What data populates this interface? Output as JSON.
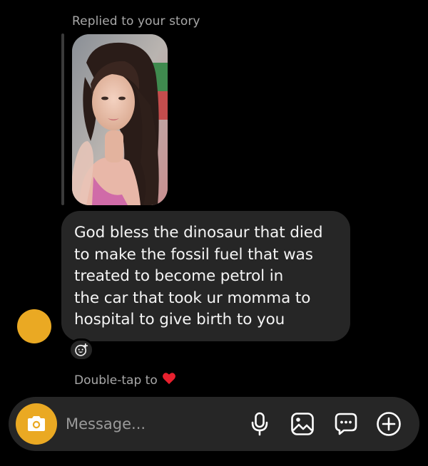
{
  "reply": {
    "label": "Replied to your story"
  },
  "message": {
    "text": "God bless the dinosaur that died\nto make the fossil fuel that was\ntreated to become petrol in\nthe car that took ur momma to\nhospital to give birth to you"
  },
  "double_tap": {
    "label": "Double-tap to",
    "emoji": "❤️"
  },
  "composer": {
    "placeholder": "Message..."
  },
  "icons": {
    "reaction": "add-reaction-icon",
    "camera": "camera-icon",
    "mic": "microphone-icon",
    "gallery": "gallery-icon",
    "sticker": "chat-bubble-icon",
    "plus": "plus-circle-icon"
  },
  "colors": {
    "accent": "#eaa923",
    "bubble": "#262626",
    "background": "#000000",
    "secondary_text": "#a8a8a8"
  }
}
